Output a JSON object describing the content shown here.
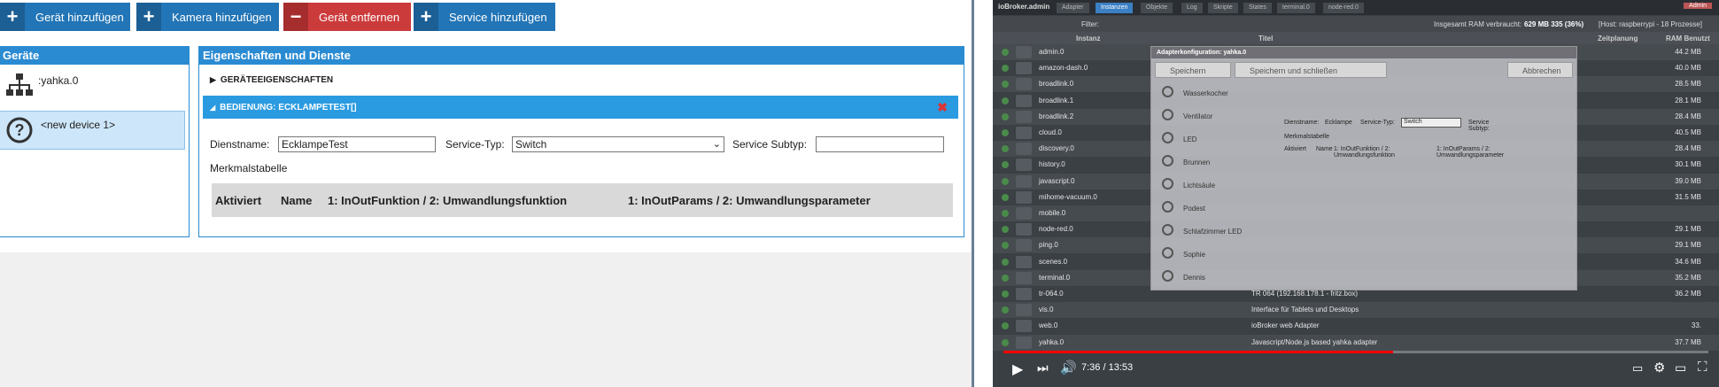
{
  "toolbar": {
    "add_device": "Gerät hinzufügen",
    "add_camera": "Kamera hinzufügen",
    "remove_device": "Gerät entfernen",
    "add_service": "Service hinzufügen"
  },
  "devices_panel": {
    "title": "Geräte",
    "items": [
      {
        "label": ":yahka.0",
        "icon": "network-tree-icon"
      },
      {
        "label": "<new device 1>",
        "icon": "question-circle-icon"
      }
    ]
  },
  "props_panel": {
    "title": "Eigenschaften und Dienste",
    "device_props_section": "GERÄTEEIGENSCHAFTEN",
    "service_section": "BEDIENUNG: ECKLAMPETEST[]",
    "service_name_label": "Dienstname:",
    "service_name_value": "EcklampeTest",
    "service_type_label": "Service-Typ:",
    "service_type_value": "Switch",
    "service_subtype_label": "Service Subtyp:",
    "service_subtype_value": "",
    "characteristics_label": "Merkmalstabelle",
    "table_headers": [
      "Aktiviert",
      "Name",
      "1: InOutFunktion / 2: Umwandlungsfunktion",
      "1: InOutParams / 2: Umwandlungsparameter"
    ]
  },
  "video": {
    "app_title": "ioBroker.admin",
    "tabs": [
      "Adapter",
      "Instanzen",
      "Objekte",
      "Log",
      "Skripte",
      "States",
      "terminal.0",
      "node-red.0"
    ],
    "filter_label": "Filter:",
    "ram_info_prefix": "Insgesamt RAM verbraucht:",
    "ram_info_value": "629 MB 335 (36%)",
    "host_info": "[Host: raspberrypi - 18 Prozesse]",
    "admin_label": "Admin",
    "columns": [
      "Instanz",
      "Titel",
      "Zeitplanung",
      "RAM Benutzt"
    ],
    "instances": [
      {
        "name": "admin.0",
        "ram": "44.2 MB",
        "title": ""
      },
      {
        "name": "amazon-dash.0",
        "ram": "40.0 MB",
        "title": ""
      },
      {
        "name": "broadlink.0",
        "ram": "28.5 MB",
        "title": ""
      },
      {
        "name": "broadlink.1",
        "ram": "28.1 MB",
        "title": ""
      },
      {
        "name": "broadlink.2",
        "ram": "28.4 MB",
        "title": ""
      },
      {
        "name": "cloud.0",
        "ram": "40.5 MB",
        "title": ""
      },
      {
        "name": "discovery.0",
        "ram": "28.4 MB",
        "title": ""
      },
      {
        "name": "history.0",
        "ram": "30.1 MB",
        "title": ""
      },
      {
        "name": "javascript.0",
        "ram": "39.0 MB",
        "title": ""
      },
      {
        "name": "mihome-vacuum.0",
        "ram": "31.5 MB",
        "title": ""
      },
      {
        "name": "mobile.0",
        "ram": "",
        "title": ""
      },
      {
        "name": "node-red.0",
        "ram": "29.1 MB",
        "title": ""
      },
      {
        "name": "ping.0",
        "ram": "29.1 MB",
        "title": ""
      },
      {
        "name": "scenes.0",
        "ram": "34.6 MB",
        "title": ""
      },
      {
        "name": "terminal.0",
        "ram": "35.2 MB",
        "title": ""
      },
      {
        "name": "tr-064.0",
        "ram": "36.2 MB",
        "title": "TR 064 (192.168.178.1 - fritz.box)"
      },
      {
        "name": "vis.0",
        "ram": "",
        "title": "Interface für Tablets und Desktops"
      },
      {
        "name": "web.0",
        "ram": "33.",
        "title": "ioBroker web Adapter"
      },
      {
        "name": "yahka.0",
        "ram": "37.7 MB",
        "title": "Javascript/Node.js based yahka adapter"
      }
    ],
    "dialog": {
      "title": "Adapterkonfiguration: yahka.0",
      "save": "Speichern",
      "save_close": "Speichern und schließen",
      "cancel": "Abbrechen",
      "services": [
        "Wasserkocher",
        "Ventilator",
        "LED",
        "Brunnen",
        "Lichtsäule",
        "Podest",
        "Schlafzimmer LED",
        "Sophie",
        "Dennis"
      ],
      "service_name_label": "Dienstname:",
      "service_name_value": "Ecklampe",
      "service_type_label": "Service-Typ:",
      "service_type_value": "Switch",
      "service_subtype_label": "Service Subtyp:",
      "characteristics_label": "Merkmalstabelle",
      "col_activated": "Aktiviert",
      "col_name": "Name",
      "col_func": "1: InOutFunktion / 2: Umwandlungsfunktion",
      "col_params": "1: InOutParams / 2: Umwandlungsparameter"
    },
    "time": "7:36 / 13:53",
    "progress": 0.553
  }
}
